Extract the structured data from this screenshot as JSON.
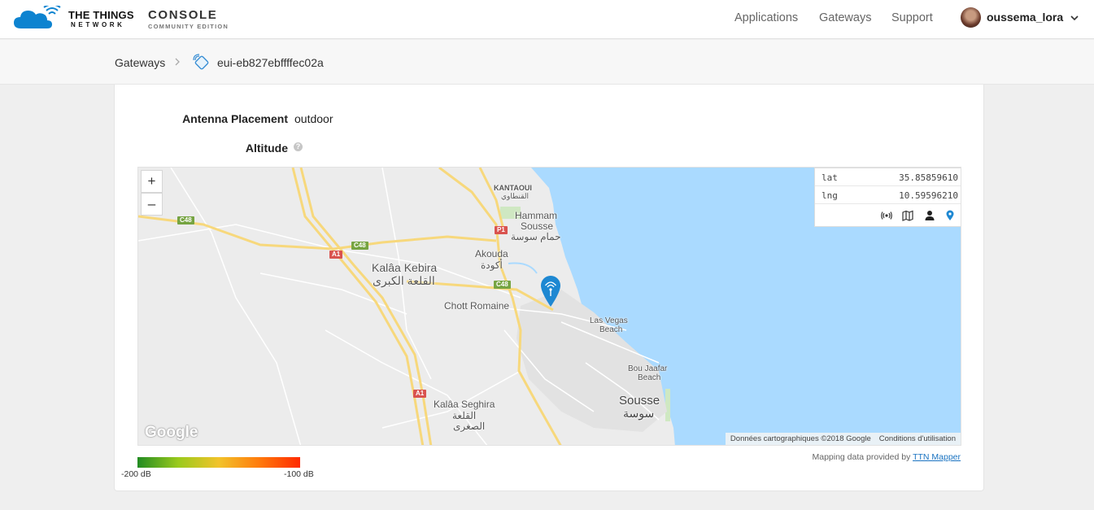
{
  "header": {
    "brand_line1": "THE THINGS",
    "brand_line2": "NETWORK",
    "product": "CONSOLE",
    "edition": "COMMUNITY EDITION",
    "nav": [
      "Applications",
      "Gateways",
      "Support"
    ],
    "username": "oussema_lora"
  },
  "breadcrumb": {
    "parent": "Gateways",
    "current": "eui-eb827ebffffec02a"
  },
  "settings": {
    "antenna_label": "Antenna Placement",
    "antenna_value": "outdoor",
    "altitude_label": "Altitude",
    "help_glyph": "?"
  },
  "map": {
    "zoom_in": "+",
    "zoom_out": "–",
    "lat_label": "lat",
    "lat_value": "35.85859610",
    "lng_label": "lng",
    "lng_value": "10.59596210",
    "toolbar_icons": [
      "antenna-icon",
      "map-icon",
      "person-icon",
      "location-pin-icon"
    ],
    "google_mark": "Google",
    "attribution": "Données cartographiques ©2018 Google",
    "terms": "Conditions d'utilisation",
    "places": {
      "kantaoui": "KANTAOUI",
      "kantaoui_ar": "القنطاوي",
      "hammam_1": "Hammam",
      "hammam_2": "Sousse",
      "hammam_ar": "حمام سوسة",
      "akouda": "Akouda",
      "akouda_ar": "أكودة",
      "kalaa_kebira": "Kalâa Kebira",
      "kalaa_kebira_ar": "القلعة الكبرى",
      "chott": "Chott Romaine",
      "lasvegas_1": "Las Vegas",
      "lasvegas_2": "Beach",
      "boujaafar_1": "Bou Jaafar",
      "boujaafar_2": "Beach",
      "sousse": "Sousse",
      "sousse_ar": "سوسة",
      "kalaa_seghira": "Kalâa Seghira",
      "kalaa_seghira_ar1": "القلعة",
      "kalaa_seghira_ar2": "الصغرى"
    },
    "roads": {
      "c48": "C48",
      "a1": "A1",
      "p1": "P1"
    },
    "colors": {
      "sea": "#aadaff",
      "land": "#ececec",
      "highway": "#f7d87c",
      "pin": "#1e88d2"
    }
  },
  "legend": {
    "min": "-200 dB",
    "max": "-100 dB",
    "mapping_prefix": "Mapping data provided by",
    "mapping_link": "TTN Mapper"
  }
}
